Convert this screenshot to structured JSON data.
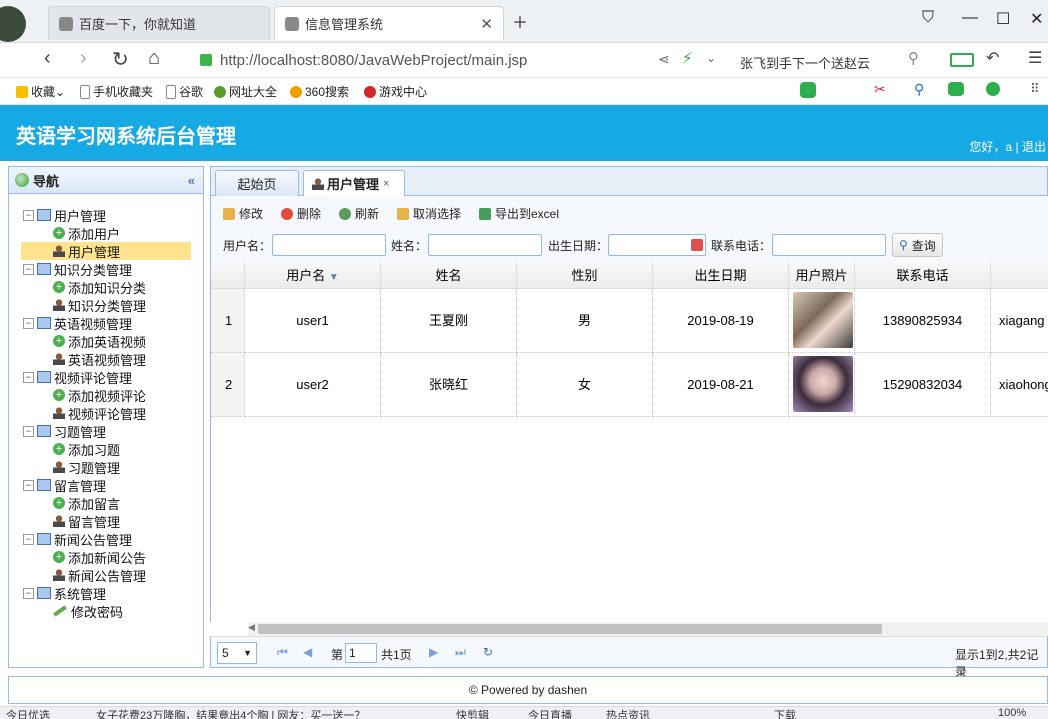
{
  "browser": {
    "tabs": [
      {
        "label": "百度一下，你就知道"
      },
      {
        "label": "信息管理系统"
      }
    ],
    "url": "http://localhost:8080/JavaWebProject/main.jsp",
    "search_text": "张飞到手下一个送赵云",
    "bookmarks": [
      "收藏",
      "手机收藏夹",
      "谷歌",
      "网址大全",
      "360搜索",
      "游戏中心"
    ]
  },
  "app": {
    "title": "英语学习网系统后台管理",
    "greeting": "您好，a | 退出"
  },
  "nav": {
    "title": "导航",
    "collapse_icon": "«",
    "groups": [
      {
        "label": "用户管理",
        "children": [
          "添加用户",
          "用户管理"
        ]
      },
      {
        "label": "知识分类管理",
        "children": [
          "添加知识分类",
          "知识分类管理"
        ]
      },
      {
        "label": "英语视频管理",
        "children": [
          "添加英语视频",
          "英语视频管理"
        ]
      },
      {
        "label": "视频评论管理",
        "children": [
          "添加视频评论",
          "视频评论管理"
        ]
      },
      {
        "label": "习题管理",
        "children": [
          "添加习题",
          "习题管理"
        ]
      },
      {
        "label": "留言管理",
        "children": [
          "添加留言",
          "留言管理"
        ]
      },
      {
        "label": "新闻公告管理",
        "children": [
          "添加新闻公告",
          "新闻公告管理"
        ]
      },
      {
        "label": "系统管理",
        "children": [
          "修改密码"
        ]
      }
    ]
  },
  "content_tabs": [
    {
      "label": "起始页"
    },
    {
      "label": "用户管理",
      "close": "×"
    }
  ],
  "toolbar": {
    "edit": "修改",
    "delete": "删除",
    "refresh": "刷新",
    "unselect": "取消选择",
    "export": "导出到excel"
  },
  "filters": {
    "username_label": "用户名：",
    "name_label": "姓名：",
    "birth_label": "出生日期：",
    "phone_label": "联系电话：",
    "query_btn": "查询"
  },
  "grid": {
    "columns": [
      "用户名",
      "姓名",
      "性别",
      "出生日期",
      "用户照片",
      "联系电话",
      ""
    ],
    "rows": [
      {
        "num": "1",
        "username": "user1",
        "name": "王夏刚",
        "gender": "男",
        "birth": "2019-08-19",
        "phone": "13890825934",
        "extra": "xiagang"
      },
      {
        "num": "2",
        "username": "user2",
        "name": "张晓红",
        "gender": "女",
        "birth": "2019-08-21",
        "phone": "15290832034",
        "extra": "xiaohong"
      }
    ]
  },
  "pager": {
    "page_size": "5",
    "page_prefix": "第",
    "page_value": "1",
    "page_total": "共1页",
    "summary": "显示1到2,共2记录"
  },
  "footer": "© Powered by dashen",
  "statusbar": [
    "今日优选",
    "女子花费23万隆胸，结果竟出4个胸 | 网友：买一送一？",
    "快剪辑",
    "今日直播",
    "热点资讯",
    "下载",
    "100%"
  ]
}
